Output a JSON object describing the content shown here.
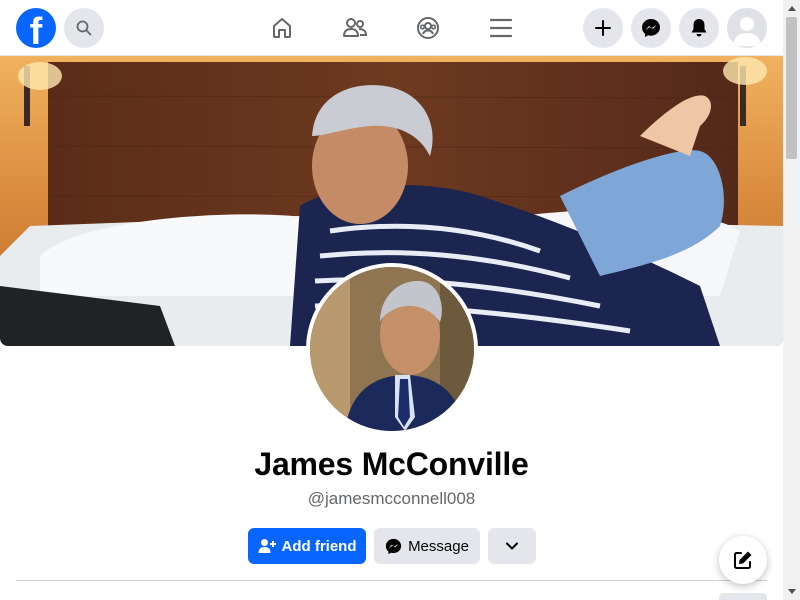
{
  "topbar": {
    "logo_letter": "f",
    "logo_color": "#0866ff",
    "icons": [
      "facebook-logo",
      "search-icon",
      "home-icon",
      "friends-icon",
      "groups-icon",
      "menu-icon",
      "plus-icon",
      "messenger-icon",
      "bell-icon",
      "avatar-placeholder"
    ]
  },
  "profile": {
    "name": "James McConville",
    "handle": "@jamesmcconnell008"
  },
  "actions": {
    "add_friend": "Add friend",
    "message": "Message"
  },
  "colors": {
    "accent": "#0866ff",
    "secondary_button": "#e4e6eb",
    "text_primary": "#050505",
    "text_secondary": "#65676b"
  }
}
